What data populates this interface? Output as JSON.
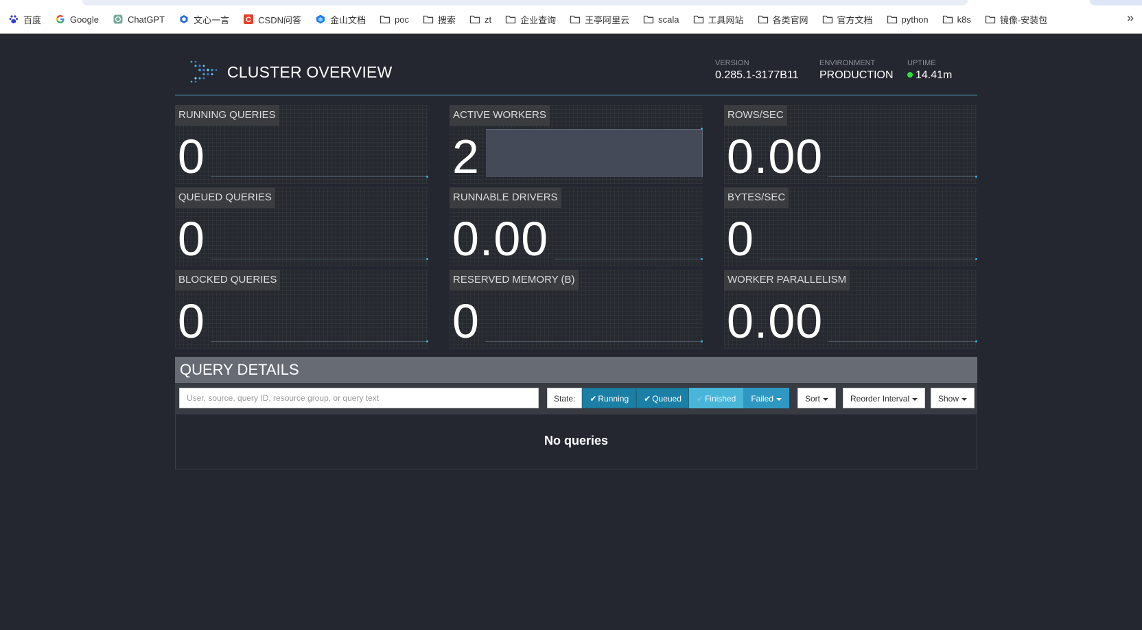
{
  "bookmarks": {
    "items": [
      {
        "label": "百度",
        "icon": "baidu-paw-icon"
      },
      {
        "label": "Google",
        "icon": "google-g-icon"
      },
      {
        "label": "ChatGPT",
        "icon": "chatgpt-icon"
      },
      {
        "label": "文心一言",
        "icon": "wenxin-icon"
      },
      {
        "label": "CSDN问答",
        "icon": "csdn-icon"
      },
      {
        "label": "金山文档",
        "icon": "kdocs-icon"
      },
      {
        "label": "poc",
        "icon": "folder-icon"
      },
      {
        "label": "搜索",
        "icon": "folder-icon"
      },
      {
        "label": "zt",
        "icon": "folder-icon"
      },
      {
        "label": "企业查询",
        "icon": "folder-icon"
      },
      {
        "label": "王亭阿里云",
        "icon": "folder-icon"
      },
      {
        "label": "scala",
        "icon": "folder-icon"
      },
      {
        "label": "工具网站",
        "icon": "folder-icon"
      },
      {
        "label": "各类官网",
        "icon": "folder-icon"
      },
      {
        "label": "官方文档",
        "icon": "folder-icon"
      },
      {
        "label": "python",
        "icon": "folder-icon"
      },
      {
        "label": "k8s",
        "icon": "folder-icon"
      },
      {
        "label": "镜像-安装包",
        "icon": "folder-icon"
      }
    ],
    "overflow": "»"
  },
  "header": {
    "title": "CLUSTER OVERVIEW",
    "version_label": "VERSION",
    "version_value": "0.285.1-3177B11",
    "environment_label": "ENVIRONMENT",
    "environment_value": "PRODUCTION",
    "uptime_label": "UPTIME",
    "uptime_value": "14.41m",
    "accent_color": "#4fb8d8",
    "status_color": "#2ee03a"
  },
  "metrics": {
    "running_queries": {
      "label": "RUNNING QUERIES",
      "value": "0"
    },
    "active_workers": {
      "label": "ACTIVE WORKERS",
      "value": "2"
    },
    "rows_per_sec": {
      "label": "ROWS/SEC",
      "value": "0.00"
    },
    "queued_queries": {
      "label": "QUEUED QUERIES",
      "value": "0"
    },
    "runnable_drivers": {
      "label": "RUNNABLE DRIVERS",
      "value": "0.00"
    },
    "bytes_per_sec": {
      "label": "BYTES/SEC",
      "value": "0"
    },
    "blocked_queries": {
      "label": "BLOCKED QUERIES",
      "value": "0"
    },
    "reserved_memory": {
      "label": "RESERVED MEMORY (B)",
      "value": "0"
    },
    "worker_parallelism": {
      "label": "WORKER PARALLELISM",
      "value": "0.00"
    }
  },
  "query_details": {
    "title": "QUERY DETAILS",
    "search_placeholder": "User, source, query ID, resource group, or query text",
    "state_label": "State:",
    "state_running": "Running",
    "state_queued": "Queued",
    "state_finished": "Finished",
    "state_failed": "Failed",
    "sort_label": "Sort",
    "reorder_label": "Reorder Interval",
    "show_label": "Show",
    "empty_message": "No queries"
  }
}
